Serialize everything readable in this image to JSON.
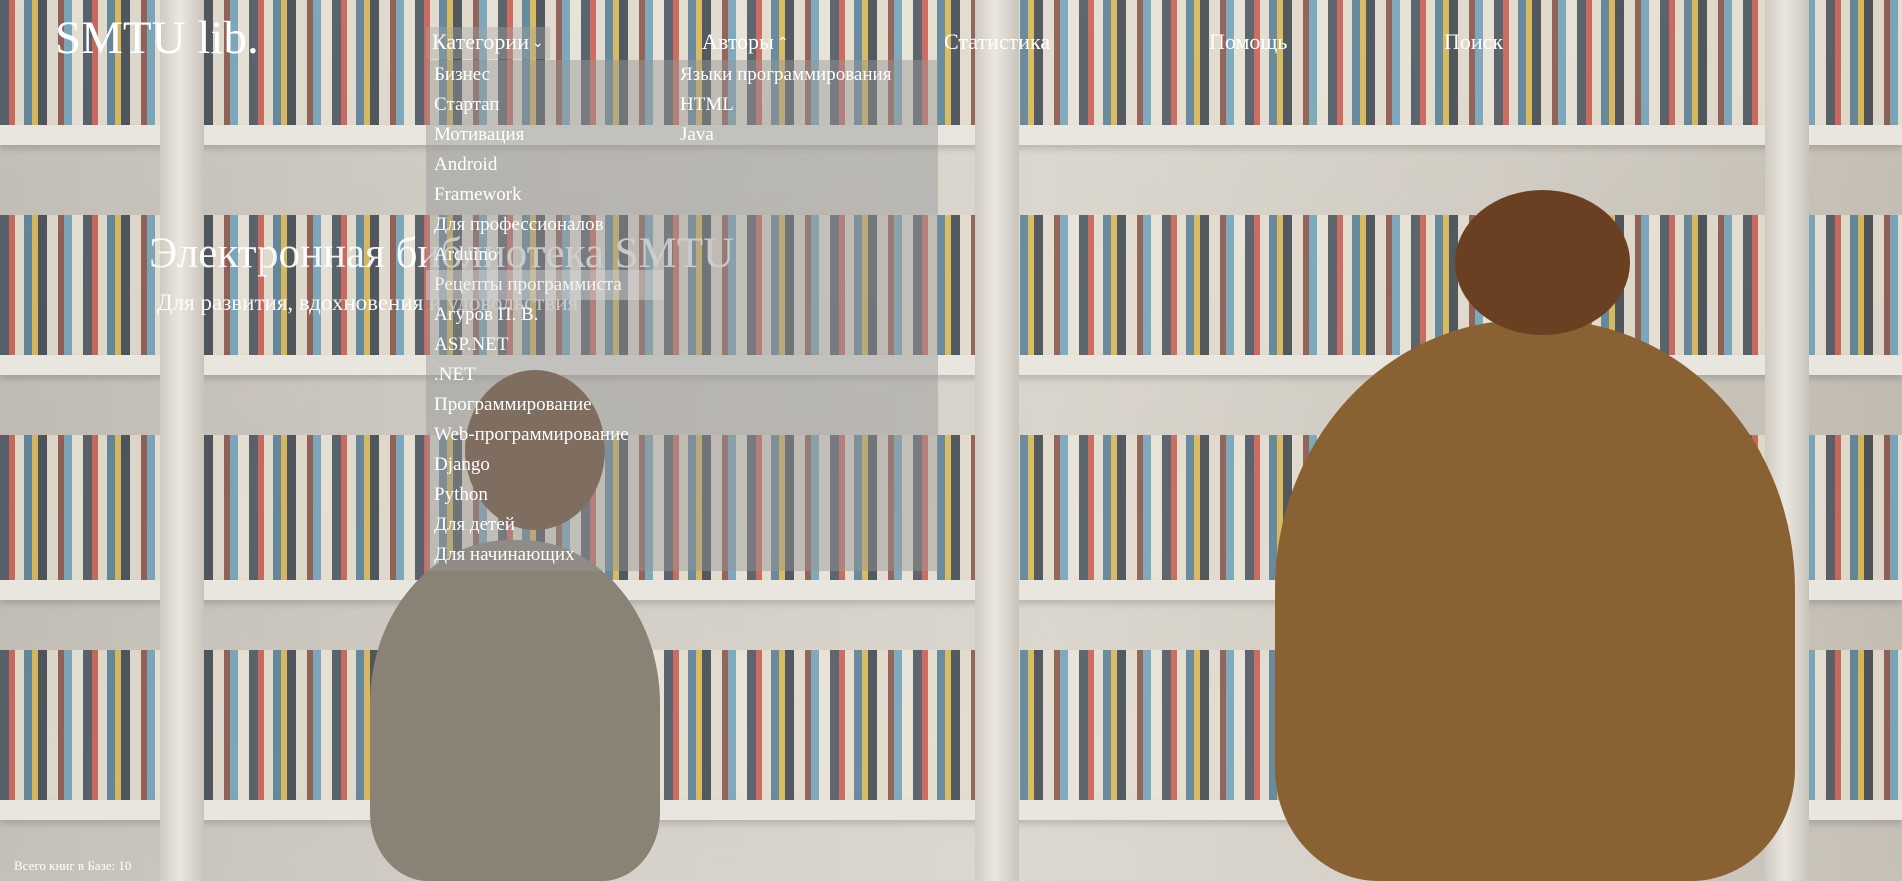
{
  "site": {
    "logo": "SMTU lib."
  },
  "nav": {
    "categories": "Категории",
    "authors": "Авторы",
    "statistics": "Статистика",
    "help": "Помощь",
    "search": "Поиск"
  },
  "categories_menu": [
    "Бизнес",
    "Стартап",
    "Мотивация",
    "Android",
    "Framework",
    "Для профессионалов",
    "Arduino",
    "Рецепты программиста",
    "Агуров П. В.",
    "ASP.NET",
    ".NET",
    "Программирование",
    "Web-программирование",
    "Django",
    "Python",
    "Для детей",
    "Для начинающих"
  ],
  "authors_menu": [
    "Языки программирования",
    "HTML",
    "Java"
  ],
  "hero": {
    "title": "Электронная библиотека SMTU",
    "subtitle": "Для развития, вдохновения и удовольствия"
  },
  "footer": {
    "books_count": "Всего книг в Базе: 10"
  },
  "icons": {
    "categories_chevron": "chevron-down-icon",
    "authors_chevron": "chevron-up-icon"
  },
  "colors": {
    "text": "#ffffff",
    "dropdown_bg": "rgba(150,150,150,0.46)",
    "hover_bg": "rgba(215,215,215,0.45)"
  }
}
